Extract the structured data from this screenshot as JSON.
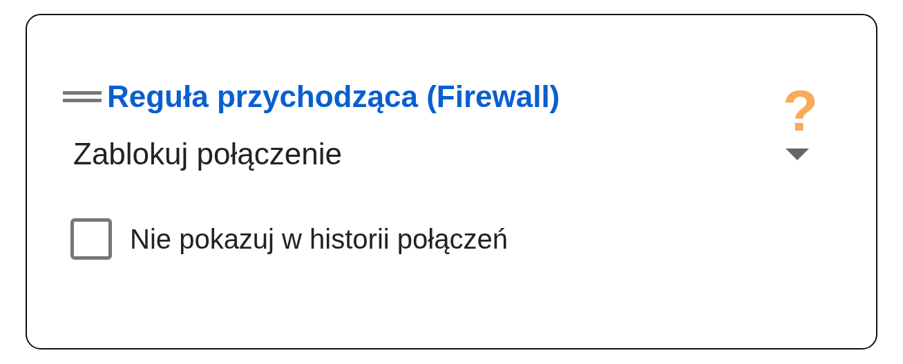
{
  "card": {
    "title": "Reguła przychodząca (Firewall)",
    "help": "?"
  },
  "dropdown": {
    "value": "Zablokuj połączenie"
  },
  "checkbox": {
    "label": "Nie pokazuj w historii połączeń",
    "checked": false
  }
}
